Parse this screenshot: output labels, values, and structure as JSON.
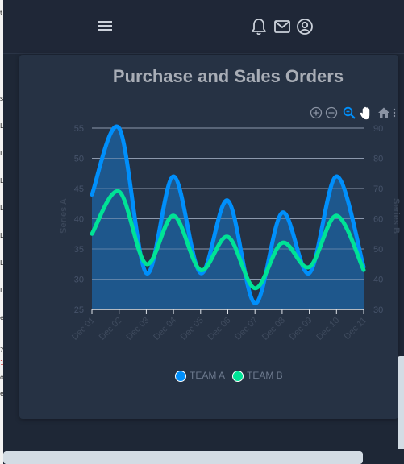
{
  "header": {
    "menu_icon": "hamburger-menu-icon",
    "notification_icon": "bell-icon",
    "mail_icon": "envelope-icon",
    "account_icon": "user-circle-icon"
  },
  "left_strip": [
    "t",
    "s",
    "L",
    "L",
    "L",
    "L",
    "L",
    "L",
    "L",
    "e",
    "?",
    "1",
    "o",
    "e"
  ],
  "card": {
    "title": "Purchase and Sales Orders"
  },
  "toolbar": {
    "icons": [
      "zoom-in-icon",
      "zoom-out-icon",
      "selection-zoom-icon",
      "pan-hand-icon",
      "reset-home-icon",
      "menu-icon"
    ]
  },
  "chart_data": {
    "type": "area",
    "title": "Purchase and Sales Orders",
    "x": [
      "Dec 01",
      "Dec 02",
      "Dec 03",
      "Dec 04",
      "Dec 05",
      "Dec 06",
      "Dec 07",
      "Dec 08",
      "Dec 09",
      "Dec 10",
      "Dec 11"
    ],
    "series": [
      {
        "name": "TEAM A",
        "values": [
          44,
          55,
          31,
          47,
          31,
          43,
          26,
          41,
          31,
          47,
          32
        ],
        "color": "#008ffb",
        "axis": "left"
      },
      {
        "name": "TEAM B",
        "values": [
          55,
          69,
          45,
          61,
          43,
          54,
          37,
          52,
          44,
          61,
          43
        ],
        "color": "#00e396",
        "axis": "right"
      }
    ],
    "ylabel": "Series A",
    "y2label": "Series B",
    "ylim": [
      25,
      55
    ],
    "y2lim": [
      30,
      90
    ],
    "yticks": [
      "25",
      "30",
      "35",
      "40",
      "45",
      "50",
      "55"
    ],
    "y2ticks": [
      "30",
      "40",
      "50",
      "60",
      "70",
      "80",
      "90"
    ],
    "grid": true,
    "legend": "bottom-center",
    "fill_color": "#1e5a90"
  },
  "legend": {
    "team_a": "TEAM A",
    "team_b": "TEAM B"
  }
}
